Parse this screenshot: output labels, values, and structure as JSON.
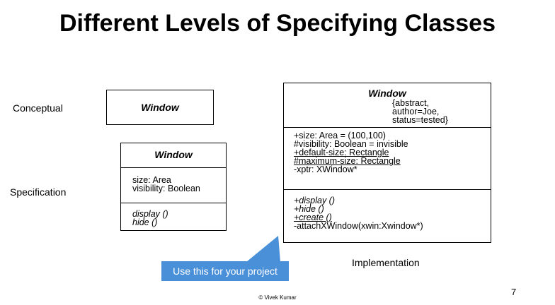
{
  "title": "Different Levels of Specifying Classes",
  "levels": {
    "conceptual": "Conceptual",
    "specification": "Specification",
    "implementation": "Implementation"
  },
  "conceptual_class": {
    "name": "Window"
  },
  "specification_class": {
    "name": "Window",
    "attributes": [
      "size: Area",
      "visibility: Boolean"
    ],
    "operations": [
      "display ()",
      "hide ()"
    ]
  },
  "implementation_class": {
    "name": "Window",
    "properties": [
      "{abstract,",
      "author=Joe,",
      "status=tested}"
    ],
    "attributes": [
      "+size: Area = (100,100)",
      "#visibility: Boolean = invisible",
      "+default-size: Rectangle",
      "#maximum-size: Rectangle",
      "-xptr: XWindow*"
    ],
    "operations": [
      "+display ()",
      "+hide ()",
      "+create ()",
      "-attachXWindow(xwin:Xwindow*)"
    ]
  },
  "callout": {
    "text": "Use this for your project",
    "color": "#4a90d9"
  },
  "footer": "© Vivek Kumar",
  "page_number": "7"
}
